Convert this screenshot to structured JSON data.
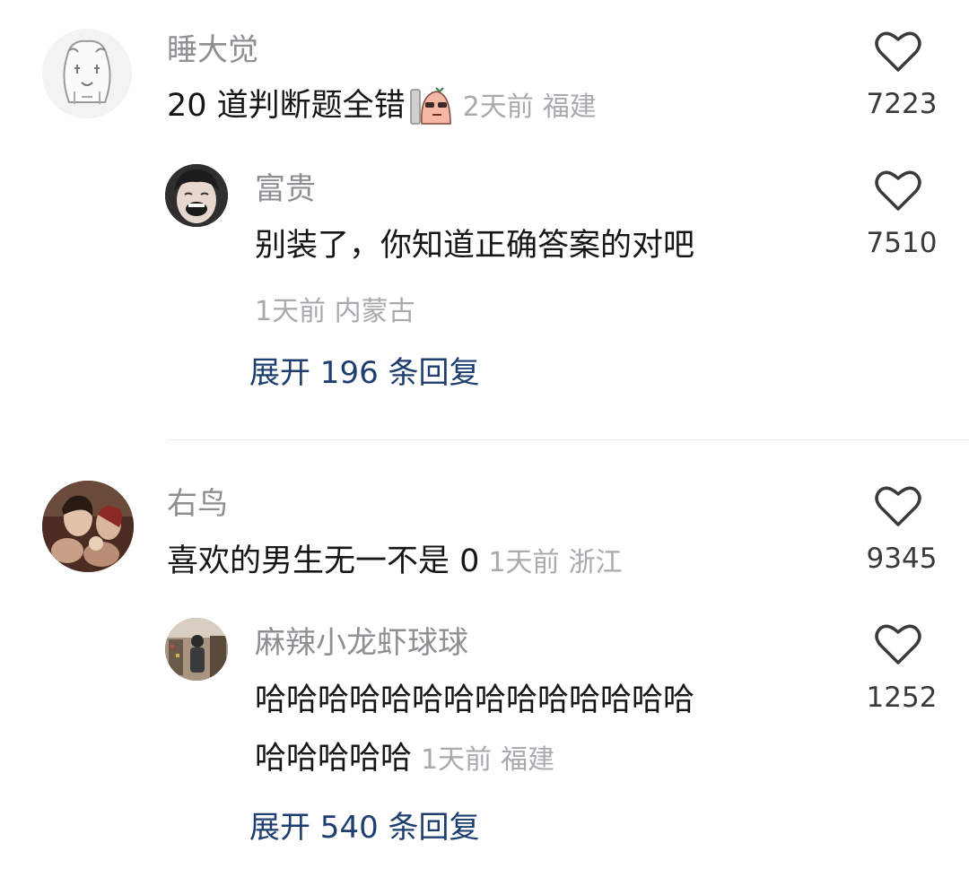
{
  "comments": [
    {
      "user": "睡大觉",
      "text": "20 道判断题全错",
      "time": "2天前",
      "location": "福建",
      "likes": "7223",
      "replies": [
        {
          "user": "富贵",
          "text": "别装了，你知道正确答案的对吧",
          "time": "1天前",
          "location": "内蒙古",
          "likes": "7510"
        }
      ],
      "expand_label": "展开 196 条回复"
    },
    {
      "user": "右鸟",
      "text": "喜欢的男生无一不是 0",
      "time": "1天前",
      "location": "浙江",
      "likes": "9345",
      "replies": [
        {
          "user": "麻辣小龙虾球球",
          "text_line1": "哈哈哈哈哈哈哈哈哈哈哈哈哈哈",
          "text_line2": "哈哈哈哈哈",
          "time": "1天前",
          "location": "福建",
          "likes": "1252"
        }
      ],
      "expand_label": "展开 540 条回复"
    }
  ],
  "icons": {
    "like": "heart-outline-icon",
    "inline_emoji": "grumpy-face-emoji-icon"
  },
  "colors": {
    "username": "#8e8e93",
    "meta": "#a9a9ae",
    "expand_link": "#1d3e6e",
    "divider": "#ececec"
  }
}
